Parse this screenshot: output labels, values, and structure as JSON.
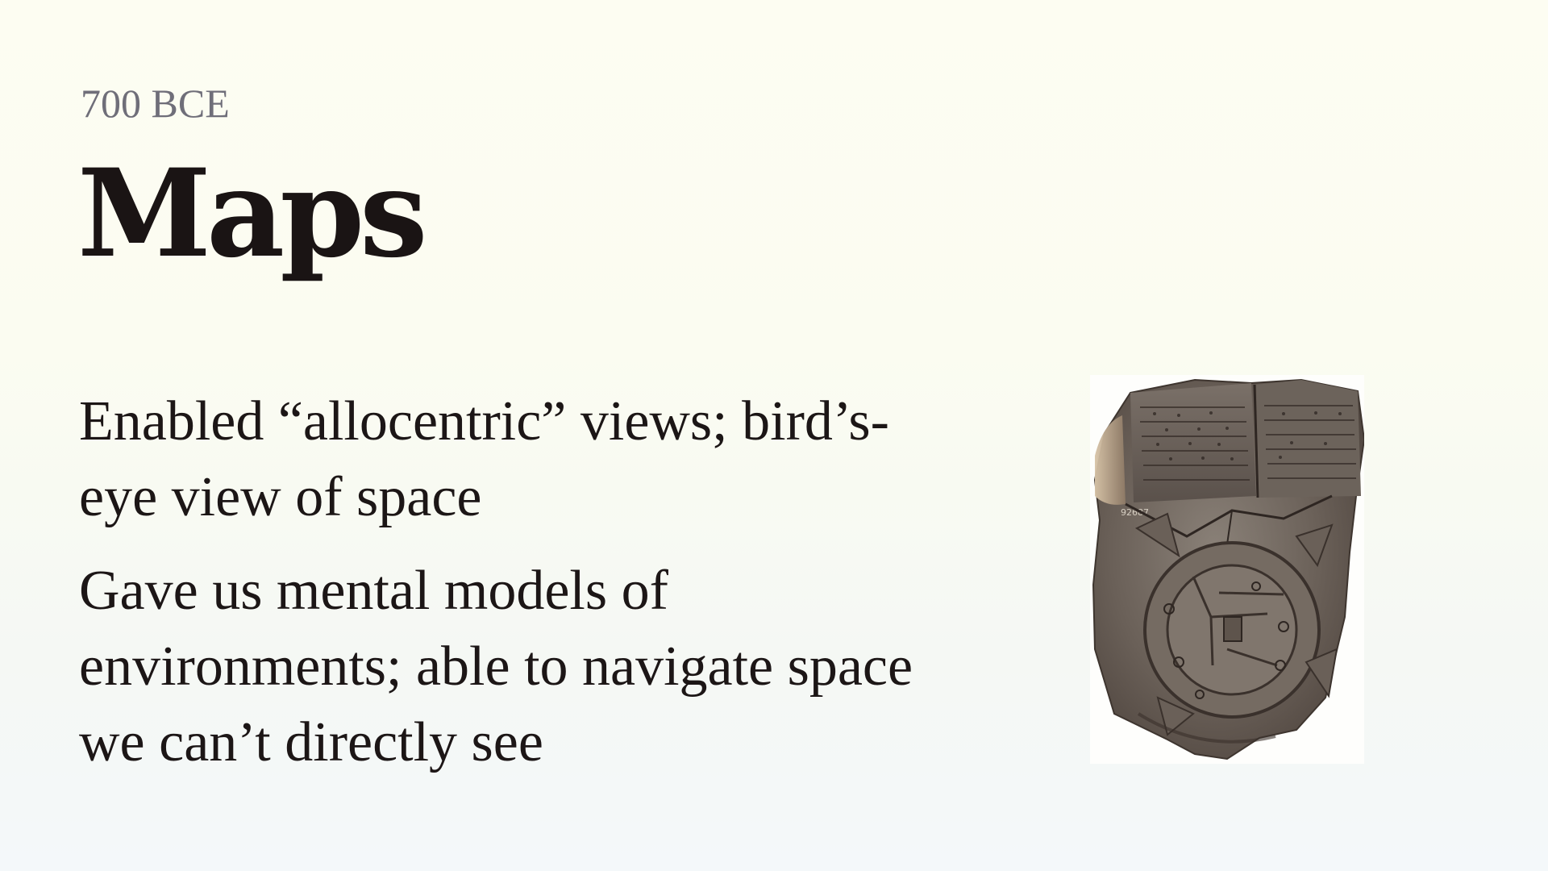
{
  "slide": {
    "eyebrow": "700 BCE",
    "title": "Maps",
    "paragraphs": [
      "Enabled “allocentric” views; bird’s-eye view of space",
      "Gave us mental models of environments; able to navigate space we can’t directly see"
    ]
  },
  "image": {
    "icon": "babylonian-map-tablet",
    "tablet_inscription": "92687"
  },
  "colors": {
    "eyebrow": "#6f6e79",
    "text": "#1c1616",
    "tablet": "#6a6058"
  }
}
